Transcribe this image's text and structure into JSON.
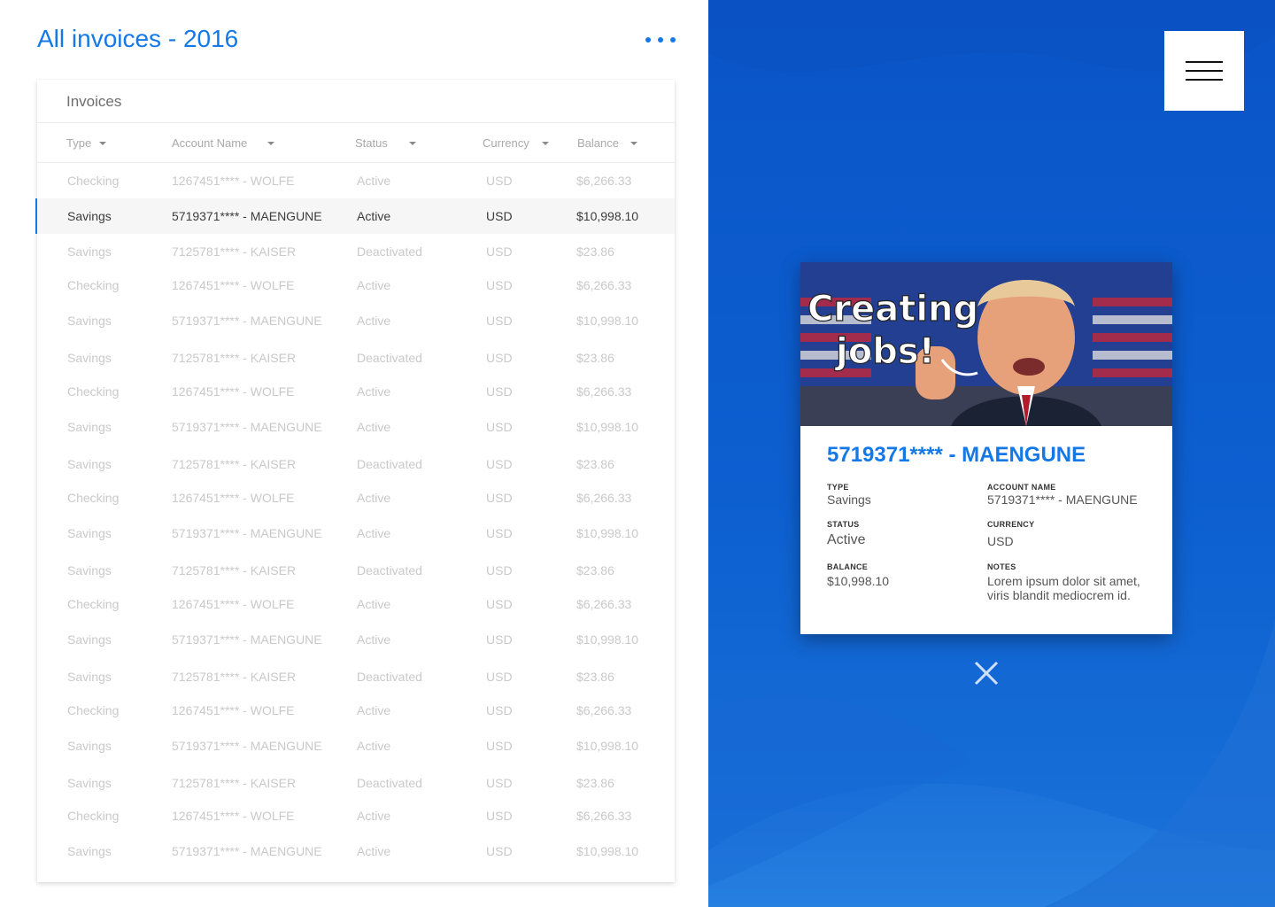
{
  "header": {
    "title": "All invoices - 2016",
    "more_icon": "more-horizontal-icon"
  },
  "table": {
    "title": "Invoices",
    "columns": [
      "Type",
      "Account Name",
      "Status",
      "Currency",
      "Balance"
    ],
    "selected_index": 1,
    "rows": [
      [
        "Checking",
        "1267451**** - WOLFE",
        "Active",
        "USD",
        "$6,266.33"
      ],
      [
        "Savings",
        "5719371**** - MAENGUNE",
        "Active",
        "USD",
        "$10,998.10"
      ],
      [
        "Savings",
        "7125781**** - KAISER",
        "Deactivated",
        "USD",
        "$23.86"
      ],
      [
        "Checking",
        "1267451**** - WOLFE",
        "Active",
        "USD",
        "$6,266.33"
      ],
      [
        "Savings",
        "5719371**** - MAENGUNE",
        "Active",
        "USD",
        "$10,998.10"
      ],
      [
        "Savings",
        "7125781**** - KAISER",
        "Deactivated",
        "USD",
        "$23.86"
      ],
      [
        "Checking",
        "1267451**** - WOLFE",
        "Active",
        "USD",
        "$6,266.33"
      ],
      [
        "Savings",
        "5719371**** - MAENGUNE",
        "Active",
        "USD",
        "$10,998.10"
      ],
      [
        "Savings",
        "7125781**** - KAISER",
        "Deactivated",
        "USD",
        "$23.86"
      ],
      [
        "Checking",
        "1267451**** - WOLFE",
        "Active",
        "USD",
        "$6,266.33"
      ],
      [
        "Savings",
        "5719371**** - MAENGUNE",
        "Active",
        "USD",
        "$10,998.10"
      ],
      [
        "Savings",
        "7125781**** - KAISER",
        "Deactivated",
        "USD",
        "$23.86"
      ],
      [
        "Checking",
        "1267451**** - WOLFE",
        "Active",
        "USD",
        "$6,266.33"
      ],
      [
        "Savings",
        "5719371**** - MAENGUNE",
        "Active",
        "USD",
        "$10,998.10"
      ],
      [
        "Savings",
        "7125781**** - KAISER",
        "Deactivated",
        "USD",
        "$23.86"
      ],
      [
        "Checking",
        "1267451**** - WOLFE",
        "Active",
        "USD",
        "$6,266.33"
      ],
      [
        "Savings",
        "5719371**** - MAENGUNE",
        "Active",
        "USD",
        "$10,998.10"
      ],
      [
        "Savings",
        "7125781**** - KAISER",
        "Deactivated",
        "USD",
        "$23.86"
      ],
      [
        "Checking",
        "1267451**** - WOLFE",
        "Active",
        "USD",
        "$6,266.33"
      ],
      [
        "Savings",
        "5719371**** - MAENGUNE",
        "Active",
        "USD",
        "$10,998.10"
      ]
    ]
  },
  "detail": {
    "image_caption": "Creating jobs!",
    "title": "5719371**** - MAENGUNE",
    "type_label": "TYPE",
    "type_value": "Savings",
    "account_label": "ACCOUNT NAME",
    "account_value": "5719371**** - MAENGUNE",
    "status_label": "STATUS",
    "status_value": "Active",
    "currency_label": "CURRENCY",
    "currency_value": "USD",
    "balance_label": "BALANCE",
    "balance_value": "$10,998.10",
    "notes_label": "NOTES",
    "notes_line1": "Lorem ipsum dolor sit amet,",
    "notes_line2": "viris blandit mediocrem id."
  },
  "colors": {
    "accent": "#1479e6",
    "panel_blue": "#0d5fd0"
  }
}
